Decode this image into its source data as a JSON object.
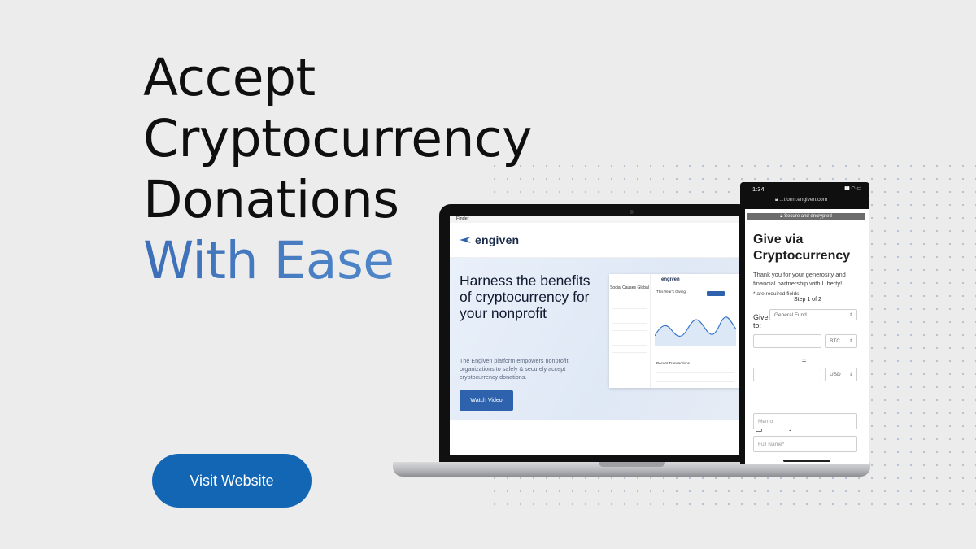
{
  "headline": {
    "line1": "Accept",
    "line2": "Cryptocurrency",
    "line3": "Donations",
    "accent": "With Ease"
  },
  "cta": {
    "label": "Visit Website"
  },
  "colors": {
    "accent": "#1366b4",
    "headline_gradient_start": "#3d6fb8",
    "headline_gradient_end": "#7cb2dd"
  },
  "laptop": {
    "menubar_app": "Finder",
    "brand": "engiven",
    "hero_title": "Harness the benefits of cryptocurrency for your nonprofit",
    "hero_body": "The Engiven platform empowers nonprofit organizations to safely & securely accept cryptocurrency donations.",
    "cta_label": "Watch Video",
    "dashboard": {
      "org_name": "Social Causes Global",
      "logo": "engiven",
      "giving_label": "This Year's Giving",
      "recent_label": "Recent Transactions"
    }
  },
  "phone": {
    "time": "1:34",
    "url": "...tform.engiven.com",
    "secure_label": "Secure and encrypted",
    "title": "Give via Cryptocurrency",
    "intro": "Thank you for your generosity and financial partnership with Liberty!",
    "required_note": "* are required fields",
    "step": "Step 1 of 2",
    "give_to_label": "Give to:",
    "fund_value": "General Fund",
    "crypto_currency": "BTC",
    "equals": "=",
    "fiat_currency": "USD",
    "anonymous_label": "Anonymous?",
    "memo_placeholder": "Memo",
    "full_name_placeholder": "Full Name*"
  }
}
